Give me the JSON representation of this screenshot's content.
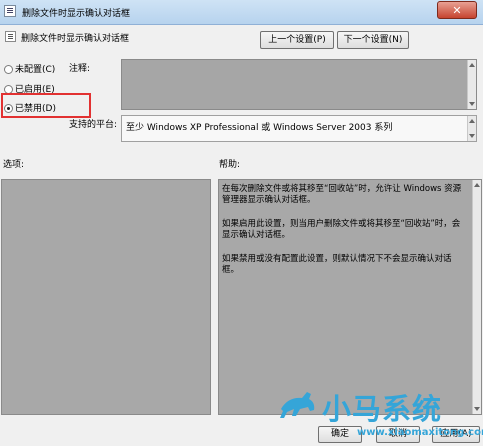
{
  "window": {
    "title": "删除文件时显示确认对话框",
    "close_glyph": "✕"
  },
  "header": {
    "setting_name": "删除文件时显示确认对话框",
    "prev_label": "上一个设置(P)",
    "next_label": "下一个设置(N)"
  },
  "radios": [
    {
      "label": "未配置(C)",
      "checked": false
    },
    {
      "label": "已启用(E)",
      "checked": false
    },
    {
      "label": "已禁用(D)",
      "checked": true
    }
  ],
  "comment_label": "注释:",
  "supported": {
    "label": "支持的平台:",
    "value": "至少 Windows XP Professional 或 Windows Server 2003 系列"
  },
  "options_label": "选项:",
  "help": {
    "label": "帮助:",
    "paragraphs": [
      "在每次删除文件或将其移至“回收站”时，允许让 Windows 资源管理器显示确认对话框。",
      "如果启用此设置，则当用户删除文件或将其移至“回收站”时，会显示确认对话框。",
      "如果禁用或没有配置此设置，则默认情况下不会显示确认对话框。"
    ]
  },
  "buttons": {
    "ok": "确定",
    "cancel": "取消",
    "apply": "应用(A)"
  },
  "watermark": {
    "brand": "小马系统",
    "url": "www.xiaomaxitong.com"
  },
  "colors": {
    "accent_red": "#e23131",
    "watermark_blue": "#35a5d8"
  }
}
